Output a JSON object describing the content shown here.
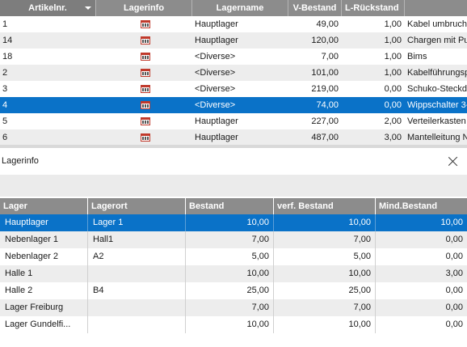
{
  "articles_grid": {
    "columns": [
      "Artikelnr.",
      "Lagerinfo",
      "Lagername",
      "V-Bestand",
      "L-Rückstand",
      ""
    ],
    "sort_column": "Artikelnr.",
    "rows": [
      {
        "nr": "1",
        "lagername": "Hauptlager",
        "v_bestand": "49,00",
        "l_rueckstand": "1,00",
        "bezeichnung": "Kabel umbruch",
        "selected": false
      },
      {
        "nr": "14",
        "lagername": "Hauptlager",
        "v_bestand": "120,00",
        "l_rueckstand": "1,00",
        "bezeichnung": "Chargen mit Pu",
        "selected": false
      },
      {
        "nr": "18",
        "lagername": "<Diverse>",
        "v_bestand": "7,00",
        "l_rueckstand": "1,00",
        "bezeichnung": "Bims",
        "selected": false
      },
      {
        "nr": "2",
        "lagername": "<Diverse>",
        "v_bestand": "101,00",
        "l_rueckstand": "1,00",
        "bezeichnung": "Kabelführungsp",
        "selected": false
      },
      {
        "nr": "3",
        "lagername": "<Diverse>",
        "v_bestand": "219,00",
        "l_rueckstand": "0,00",
        "bezeichnung": "Schuko-Steckdo",
        "selected": false
      },
      {
        "nr": "4",
        "lagername": "<Diverse>",
        "v_bestand": "74,00",
        "l_rueckstand": "0,00",
        "bezeichnung": "Wippschalter 3-",
        "selected": true
      },
      {
        "nr": "5",
        "lagername": "Hauptlager",
        "v_bestand": "227,00",
        "l_rueckstand": "2,00",
        "bezeichnung": "Verteilerkasten",
        "selected": false
      },
      {
        "nr": "6",
        "lagername": "Hauptlager",
        "v_bestand": "487,00",
        "l_rueckstand": "3,00",
        "bezeichnung": "Mantelleitung N",
        "selected": false
      }
    ]
  },
  "lagerinfo_panel": {
    "title": "Lagerinfo",
    "columns": [
      "Lager",
      "Lagerort",
      "Bestand",
      "verf. Bestand",
      "Mind.Bestand"
    ],
    "rows": [
      {
        "lager": "Hauptlager",
        "lagerort": "Lager 1",
        "bestand": "10,00",
        "verf_bestand": "10,00",
        "mind_bestand": "10,00",
        "selected": true
      },
      {
        "lager": "Nebenlager 1",
        "lagerort": "Hall1",
        "bestand": "7,00",
        "verf_bestand": "7,00",
        "mind_bestand": "0,00",
        "selected": false
      },
      {
        "lager": "Nebenlager 2",
        "lagerort": "A2",
        "bestand": "5,00",
        "verf_bestand": "5,00",
        "mind_bestand": "0,00",
        "selected": false
      },
      {
        "lager": "Halle 1",
        "lagerort": "",
        "bestand": "10,00",
        "verf_bestand": "10,00",
        "mind_bestand": "3,00",
        "selected": false
      },
      {
        "lager": "Halle 2",
        "lagerort": "B4",
        "bestand": "25,00",
        "verf_bestand": "25,00",
        "mind_bestand": "0,00",
        "selected": false
      },
      {
        "lager": "Lager Freiburg",
        "lagerort": "",
        "bestand": "7,00",
        "verf_bestand": "7,00",
        "mind_bestand": "0,00",
        "selected": false
      },
      {
        "lager": "Lager Gundelfi...",
        "lagerort": "",
        "bestand": "10,00",
        "verf_bestand": "10,00",
        "mind_bestand": "0,00",
        "selected": false
      }
    ]
  },
  "colors": {
    "header_bg": "#8c8c8c",
    "selection": "#0a72c8",
    "alt_row": "#ededed",
    "stock_icon": "#c0392b"
  },
  "icons": {
    "lagerinfo_cell": "warehouse-stock-icon",
    "sort": "sort-descending-icon",
    "close": "close-icon"
  }
}
